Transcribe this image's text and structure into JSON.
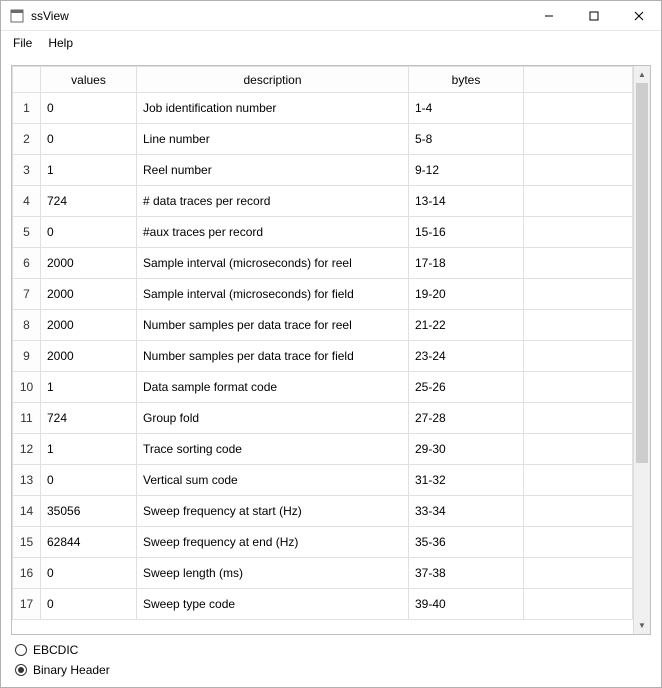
{
  "window": {
    "title": "ssView"
  },
  "menu": {
    "file": "File",
    "help": "Help"
  },
  "table": {
    "headers": {
      "values": "values",
      "description": "description",
      "bytes": "bytes"
    },
    "rows": [
      {
        "n": "1",
        "value": "0",
        "desc": "Job identification number",
        "bytes": "1-4"
      },
      {
        "n": "2",
        "value": "0",
        "desc": "Line number",
        "bytes": "5-8"
      },
      {
        "n": "3",
        "value": "1",
        "desc": "Reel number",
        "bytes": "9-12"
      },
      {
        "n": "4",
        "value": "724",
        "desc": "# data traces per record",
        "bytes": "13-14"
      },
      {
        "n": "5",
        "value": "0",
        "desc": "#aux traces per record",
        "bytes": "15-16"
      },
      {
        "n": "6",
        "value": "2000",
        "desc": "Sample interval (microseconds) for reel",
        "bytes": "17-18"
      },
      {
        "n": "7",
        "value": "2000",
        "desc": "Sample interval (microseconds) for field",
        "bytes": "19-20"
      },
      {
        "n": "8",
        "value": "2000",
        "desc": "Number samples per data trace for reel",
        "bytes": "21-22"
      },
      {
        "n": "9",
        "value": "2000",
        "desc": "Number samples per data trace for field",
        "bytes": "23-24"
      },
      {
        "n": "10",
        "value": "1",
        "desc": "Data sample format code",
        "bytes": "25-26"
      },
      {
        "n": "11",
        "value": "724",
        "desc": "Group fold",
        "bytes": "27-28"
      },
      {
        "n": "12",
        "value": "1",
        "desc": "Trace sorting code",
        "bytes": "29-30"
      },
      {
        "n": "13",
        "value": "0",
        "desc": "Vertical sum code",
        "bytes": "31-32"
      },
      {
        "n": "14",
        "value": "35056",
        "desc": "Sweep frequency at start (Hz)",
        "bytes": "33-34"
      },
      {
        "n": "15",
        "value": "62844",
        "desc": "Sweep frequency at end (Hz)",
        "bytes": "35-36"
      },
      {
        "n": "16",
        "value": "0",
        "desc": "Sweep length (ms)",
        "bytes": "37-38"
      },
      {
        "n": "17",
        "value": "0",
        "desc": "Sweep type code",
        "bytes": "39-40"
      }
    ]
  },
  "radios": {
    "ebcdic": "EBCDIC",
    "binary": "Binary Header",
    "selected": "binary"
  }
}
